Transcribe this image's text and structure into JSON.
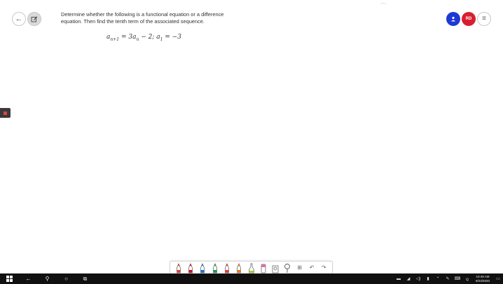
{
  "problem": {
    "line1": "Determine whether the following is a functional equation or a difference",
    "line2": "equation.  Then find the tenth term of the associated sequence."
  },
  "equation": {
    "a": "a",
    "sub_left": "n+1",
    "eq1": " = 3a",
    "sub_mid": "n",
    "rest": " − 2;  a",
    "sub_one": "1",
    "end": " = −3"
  },
  "header": {
    "user_initials": "RD"
  },
  "toolbar": {
    "tools": [
      {
        "icon": "pen-icon",
        "color": "#e0423a"
      },
      {
        "icon": "pen-icon",
        "color": "#c8102e"
      },
      {
        "icon": "pen-icon",
        "color": "#1e73d8"
      },
      {
        "icon": "pen-icon",
        "color": "#1a9a55"
      },
      {
        "icon": "pen-icon",
        "color": "#e23a3a"
      },
      {
        "icon": "pen-icon",
        "color": "#e07a2a"
      },
      {
        "icon": "highlighter-icon",
        "color": "#a9c93c"
      },
      {
        "icon": "eraser-icon",
        "color": "#e070a8"
      },
      {
        "icon": "shapes-icon",
        "color": "#666666"
      },
      {
        "icon": "lasso-icon",
        "color": "#666666"
      }
    ]
  },
  "taskbar": {
    "time": "10:49 AM",
    "date": "9/23/2020"
  },
  "colors": {
    "user_button": "#1e3ad4",
    "initials_button": "#d81f2f"
  }
}
